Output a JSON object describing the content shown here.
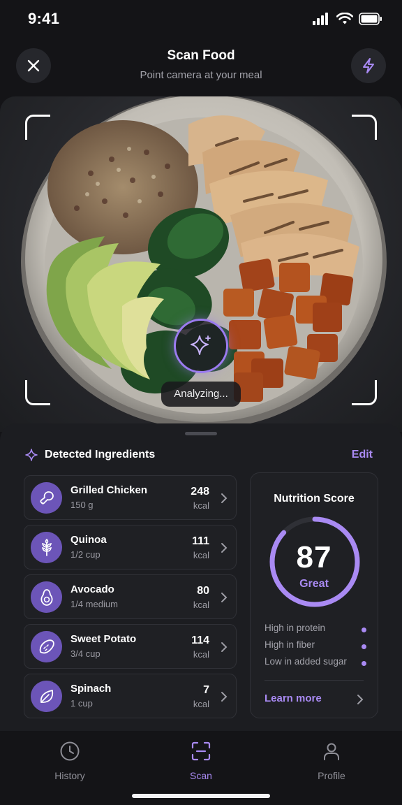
{
  "status_bar": {
    "time": "9:41"
  },
  "header": {
    "title": "Scan Food",
    "subtitle": "Point camera at your meal",
    "close_icon": "close-icon",
    "flash_icon": "lightning-icon"
  },
  "camera": {
    "status_text": "Analyzing..."
  },
  "ingredients": {
    "title": "Detected Ingredients",
    "edit_label": "Edit",
    "items": [
      {
        "name": "Grilled Chicken",
        "qty": "150 g",
        "kcal": "248",
        "unit": "kcal",
        "icon": "drumstick-icon"
      },
      {
        "name": "Quinoa",
        "qty": "1/2 cup",
        "kcal": "111",
        "unit": "kcal",
        "icon": "grain-icon"
      },
      {
        "name": "Avocado",
        "qty": "1/4 medium",
        "kcal": "80",
        "unit": "kcal",
        "icon": "avocado-icon"
      },
      {
        "name": "Sweet Potato",
        "qty": "3/4 cup",
        "kcal": "114",
        "unit": "kcal",
        "icon": "sweet-potato-icon"
      },
      {
        "name": "Spinach",
        "qty": "1 cup",
        "kcal": "7",
        "unit": "kcal",
        "icon": "leaf-icon"
      }
    ]
  },
  "nutrition": {
    "title": "Nutrition Score",
    "score": "87",
    "score_fraction": 0.87,
    "rating": "Great",
    "highlights": [
      "High in protein",
      "High in fiber",
      "Low in added sugar"
    ],
    "learn_more": "Learn more"
  },
  "tabs": [
    {
      "label": "History",
      "icon": "clock-icon",
      "active": false
    },
    {
      "label": "Scan",
      "icon": "scan-icon",
      "active": true
    },
    {
      "label": "Profile",
      "icon": "person-icon",
      "active": false
    }
  ],
  "colors": {
    "accent": "#a98af3",
    "background": "#141417",
    "card": "#1f2024"
  }
}
